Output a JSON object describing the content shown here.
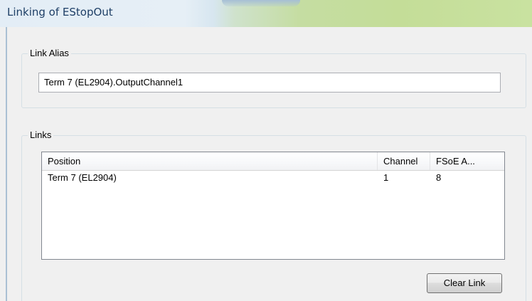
{
  "window": {
    "title": "Linking of EStopOut"
  },
  "link_alias": {
    "group_label": "Link Alias",
    "value": "Term 7 (EL2904).OutputChannel1"
  },
  "links": {
    "group_label": "Links",
    "columns": {
      "position": "Position",
      "channel": "Channel",
      "fsoe_address": "FSoE A..."
    },
    "rows": [
      {
        "position": "Term 7 (EL2904)",
        "channel": "1",
        "fsoe_address": "8"
      }
    ],
    "clear_link_label": "Clear Link"
  }
}
